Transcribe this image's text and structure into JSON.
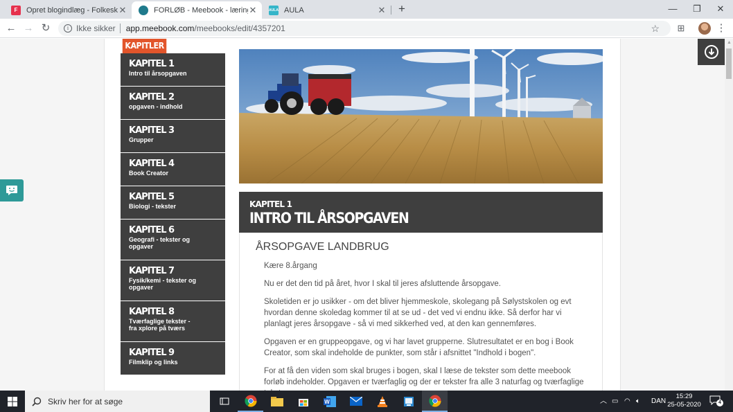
{
  "browser": {
    "tabs": [
      {
        "title": "Opret blogindlæg - Folkeskolen.dk",
        "favicon": "F"
      },
      {
        "title": "FORLØB - Meebook - læringsplatform",
        "favicon": "M"
      },
      {
        "title": "AULA",
        "favicon": "AULA"
      }
    ],
    "security_label": "Ikke sikker",
    "url_host": "app.meebook.com",
    "url_path": "/meebooks/edit/4357201"
  },
  "sidebar": {
    "header": "KAPITLER",
    "chapters": [
      {
        "number": "KAPITEL 1",
        "title": "Intro til årsopgaven"
      },
      {
        "number": "KAPITEL 2",
        "title": "opgaven - indhold"
      },
      {
        "number": "KAPITEL 3",
        "title": "Grupper"
      },
      {
        "number": "KAPITEL 4",
        "title": "Book Creator"
      },
      {
        "number": "KAPITEL 5",
        "title": "Biologi - tekster"
      },
      {
        "number": "KAPITEL 6",
        "title": "Geografi - tekster og opgaver"
      },
      {
        "number": "KAPITEL 7",
        "title": "Fysik/kemi - tekster og opgaver"
      },
      {
        "number": "KAPITEL 8",
        "title": "Tværfaglige tekster - fra xplore på tværs"
      },
      {
        "number": "KAPITEL 9",
        "title": "Filmklip og links"
      }
    ]
  },
  "chapter": {
    "kicker": "KAPITEL 1",
    "title": "INTRO TIL ÅRSOPGAVEN",
    "section_title": "ÅRSOPGAVE LANDBRUG",
    "paragraphs": [
      "Kære 8.årgang",
      "Nu er det den tid på året, hvor I skal til jeres afsluttende årsopgave.",
      "Skoletiden er jo usikker - om det bliver hjemmeskole, skolegang på Sølystskolen og evt hvordan denne skoledag kommer til at se ud - det ved vi endnu ikke. Så derfor har vi planlagt jeres årsopgave - så vi med sikkerhed ved, at den kan gennemføres.",
      "Opgaven er en gruppeopgave, og vi har lavet grupperne. Slutresultatet er en bog i Book Creator, som skal indeholde de punkter, som står i afsnittet \"Indhold i bogen\".",
      "For at få den viden som skal bruges i bogen, skal I læse de tekster som dette meebook forløb indeholder. Opgaven er tværfaglig og der er tekster fra alle 3 naturfag og tværfaglige tekster."
    ]
  },
  "taskbar": {
    "search_placeholder": "Skriv her for at søge",
    "language": "DAN",
    "time": "15:29",
    "date": "25-05-2020",
    "notification_count": "4"
  },
  "colors": {
    "accent": "#e2552b",
    "chapter_bg": "#3f3f3f",
    "feedback_teal": "#2e9a98"
  }
}
